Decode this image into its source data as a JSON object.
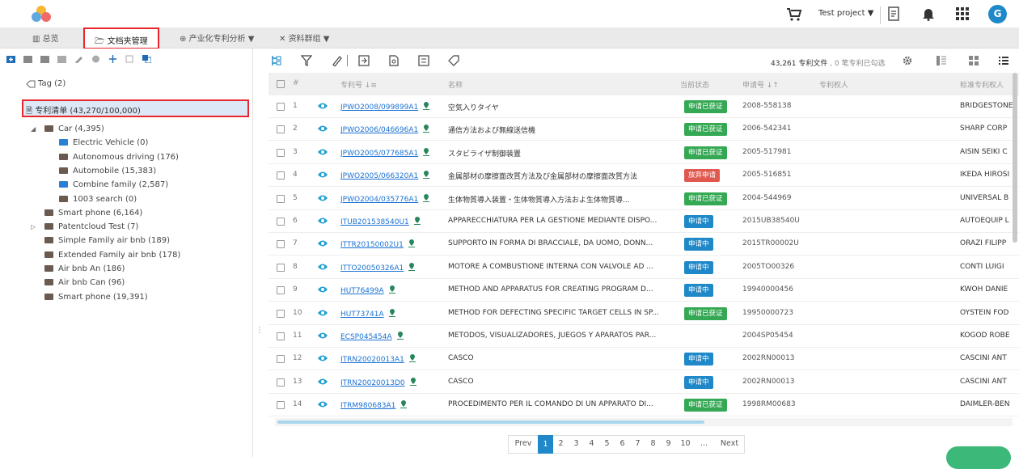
{
  "header": {
    "project_label": "Test project",
    "avatar_letter": "G"
  },
  "nav": {
    "items": [
      {
        "label": "总览"
      },
      {
        "label": "文档夹管理"
      },
      {
        "label": "产业化专利分析 ▼"
      },
      {
        "label": "资料群组 ▼"
      }
    ]
  },
  "left": {
    "tag_label": "Tag (2)",
    "patent_list_label": "专利清单 (43,270/100,000)",
    "tree": [
      {
        "label": "Car  (4,395)",
        "color": "#6b5a50",
        "level": 1,
        "expanded": true
      },
      {
        "label": "Electric Vehicle  (0)",
        "color": "#2a7fd4",
        "level": 2
      },
      {
        "label": "Autonomous driving  (176)",
        "color": "#6b5a50",
        "level": 2
      },
      {
        "label": "Automobile  (15,383)",
        "color": "#6b5a50",
        "level": 2
      },
      {
        "label": "Combine family  (2,587)",
        "color": "#2a7fd4",
        "level": 2
      },
      {
        "label": "1003 search  (0)",
        "color": "#6b5a50",
        "level": 2
      },
      {
        "label": "Smart phone  (6,164)",
        "color": "#6b5a50",
        "level": 1
      },
      {
        "label": "Patentcloud Test  (7)",
        "color": "#6b5a50",
        "level": 1,
        "collapsed": true
      },
      {
        "label": "Simple Family air bnb  (189)",
        "color": "#6b5a50",
        "level": 1
      },
      {
        "label": "Extended Family air bnb  (178)",
        "color": "#6b5a50",
        "level": 1
      },
      {
        "label": "Air bnb An  (186)",
        "color": "#6b5a50",
        "level": 1
      },
      {
        "label": "Air bnb Can  (96)",
        "color": "#6b5a50",
        "level": 1
      },
      {
        "label": "Smart phone  (19,391)",
        "color": "#6b5a50",
        "level": 1
      }
    ]
  },
  "main": {
    "count_main": "43,261 专利文件",
    "count_sub": " , 0 笔专利已勾选",
    "columns": {
      "num": "#",
      "patent_no": "专利号 ↓≡",
      "title": "名称",
      "status": "当前状态",
      "app_no": "申请号 ↓↑",
      "right": "专利权人",
      "assignee": "标准专利权人"
    },
    "rows": [
      {
        "n": "1",
        "pn": "JPWO2008/099899A1",
        "title": "空気入りタイヤ",
        "status": "申请已获证",
        "status_color": "#34a853",
        "app": "2008-558138",
        "assignee": "BRIDGESTONE"
      },
      {
        "n": "2",
        "pn": "JPWO2006/046696A1",
        "title": "通信方法および無線送信機",
        "status": "申请已获证",
        "status_color": "#34a853",
        "app": "2006-542341",
        "assignee": "SHARP CORP"
      },
      {
        "n": "3",
        "pn": "JPWO2005/077685A1",
        "title": "スタビライザ制御装置",
        "status": "申请已获证",
        "status_color": "#34a853",
        "app": "2005-517981",
        "assignee": "AISIN SEIKI C"
      },
      {
        "n": "4",
        "pn": "JPWO2005/066320A1",
        "title": "金属部材の摩擦面改質方法及び金属部材の摩擦面改質方法",
        "status": "放弃申请",
        "status_color": "#e0584e",
        "app": "2005-516851",
        "assignee": "IKEDA HIROSI"
      },
      {
        "n": "5",
        "pn": "JPWO2004/035776A1",
        "title": "生体物質導入装置・生体物質導入方法およ生体物質導...",
        "status": "申请已获证",
        "status_color": "#34a853",
        "app": "2004-544969",
        "assignee": "UNIVERSAL B"
      },
      {
        "n": "6",
        "pn": "ITUB201538540U1",
        "title": "APPARECCHIATURA PER LA GESTIONE MEDIANTE DISPO...",
        "status": "申请中",
        "status_color": "#1e88c8",
        "app": "2015UB38540U",
        "assignee": "AUTOEQUIP L"
      },
      {
        "n": "7",
        "pn": "ITTR20150002U1",
        "title": "SUPPORTO IN FORMA DI BRACCIALE, DA UOMO, DONN...",
        "status": "申请中",
        "status_color": "#1e88c8",
        "app": "2015TR00002U",
        "assignee": "ORAZI FILIPP"
      },
      {
        "n": "8",
        "pn": "ITTO20050326A1",
        "title": "MOTORE A COMBUSTIONE INTERNA CON VALVOLE AD ...",
        "status": "申请中",
        "status_color": "#1e88c8",
        "app": "2005TO00326",
        "assignee": "CONTI LUIGI"
      },
      {
        "n": "9",
        "pn": "HUT76499A",
        "title": "METHOD AND APPARATUS FOR CREATING PROGRAM D...",
        "status": "申请中",
        "status_color": "#1e88c8",
        "app": "19940000456",
        "assignee": "KWOH DANIE"
      },
      {
        "n": "10",
        "pn": "HUT73741A",
        "title": "METHOD FOR DEFECTING SPECIFIC TARGET CELLS IN SP...",
        "status": "申请已获证",
        "status_color": "#34a853",
        "app": "19950000723",
        "assignee": "OYSTEIN FOD"
      },
      {
        "n": "11",
        "pn": "ECSP045454A",
        "title": "METODOS, VISUALIZADORES, JUEGOS Y APARATOS PAR...",
        "status": "",
        "status_color": "",
        "app": "2004SP05454",
        "assignee": "KOGOD ROBE"
      },
      {
        "n": "12",
        "pn": "ITRN20020013A1",
        "title": "CASCO",
        "status": "申请中",
        "status_color": "#1e88c8",
        "app": "2002RN00013",
        "assignee": "CASCINI ANT"
      },
      {
        "n": "13",
        "pn": "ITRN20020013D0",
        "title": "CASCO",
        "status": "申请中",
        "status_color": "#1e88c8",
        "app": "2002RN00013",
        "assignee": "CASCINI ANT"
      },
      {
        "n": "14",
        "pn": "ITRM980683A1",
        "title": "PROCEDIMENTO PER IL COMANDO DI UN APPARATO DI...",
        "status": "申请已获证",
        "status_color": "#34a853",
        "app": "1998RM00683",
        "assignee": "DAIMLER-BEN"
      }
    ],
    "pager": {
      "prev": "Prev",
      "pages": [
        "1",
        "2",
        "3",
        "4",
        "5",
        "6",
        "7",
        "8",
        "9",
        "10",
        "..."
      ],
      "current": "1",
      "next": "Next"
    }
  }
}
